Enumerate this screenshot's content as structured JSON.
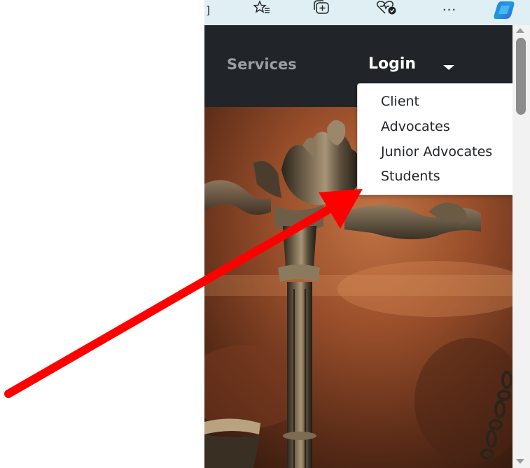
{
  "toolbar": {
    "icons": [
      "split-screen-icon",
      "favorites-icon",
      "collections-icon",
      "browser-essentials-icon",
      "more-icon",
      "copilot-icon"
    ],
    "more_glyph": "···"
  },
  "navbar": {
    "services_label": "Services",
    "login_label": "Login"
  },
  "dropdown": {
    "items": [
      "Client",
      "Advocates",
      "Junior Advocates",
      "Students"
    ]
  },
  "colors": {
    "navbar_bg": "#212529",
    "annotation_arrow": "#ff0000",
    "toolbar_bg": "#dfeff4"
  }
}
